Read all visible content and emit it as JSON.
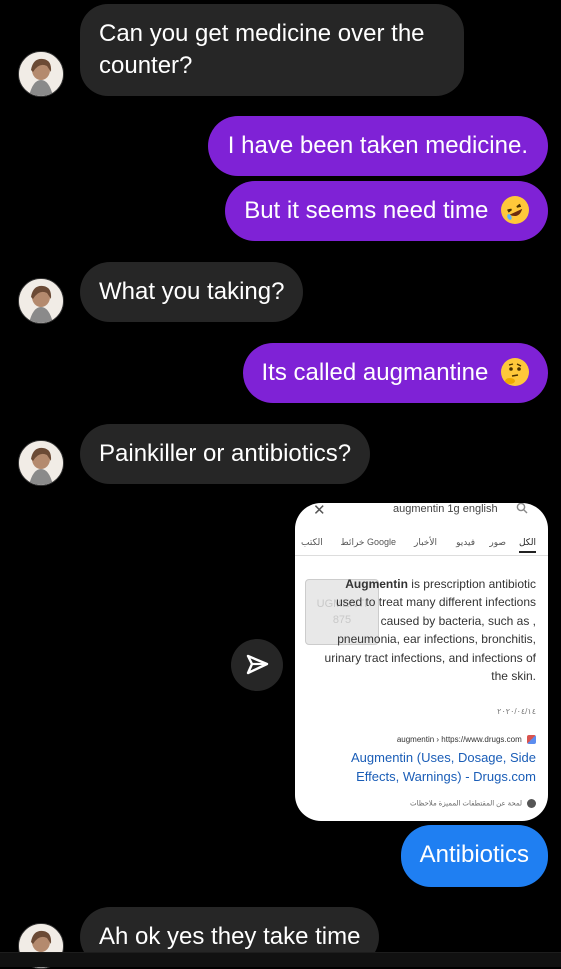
{
  "messages": [
    {
      "text_line1": "Can you get medicine over the",
      "text_line2": "counter?"
    },
    {
      "text": "I have been taken medicine."
    },
    {
      "text": "But it seems need time"
    },
    {
      "text": "What you taking?"
    },
    {
      "text": "Its called augmantine"
    },
    {
      "text": "Painkiller or antibiotics?"
    },
    {
      "text": "Antibiotics"
    },
    {
      "text": "Ah ok yes they take time"
    }
  ],
  "shared_card": {
    "search_query": "augmentin 1g english",
    "tabs": [
      "الكل",
      "صور",
      "فيديو",
      "الأخبار",
      "خرائط Google",
      "الكتب"
    ],
    "pill_text_line1": "UGMENTI",
    "pill_text_line2": "875",
    "snippet_bold": "Augmentin",
    "snippet_rest": " is prescription antibiotic used to treat many different infections caused by bacteria, such as , pneumonia, ear infections, bronchitis, urinary tract infections, and infections of the skin.",
    "date": "٢٠٢٠/٠٤/١٤",
    "url": "augmentin › https://www.drugs.com",
    "link_title": "Augmentin (Uses, Dosage, Side Effects, Warnings) - Drugs.com",
    "footer": "لمحة عن المقتطفات المميزة   ملاحظات"
  },
  "colors": {
    "background": "#000000",
    "incoming_bubble": "#262626",
    "outgoing_bubble_purple": "#7f22d6",
    "outgoing_bubble_blue": "#1f7ff2",
    "link": "#1a5db7"
  },
  "icons": {
    "emoji_laughing": "rolling-on-floor-laughing-emoji",
    "emoji_thinking": "thinking-face-emoji",
    "share": "send-arrow-icon"
  }
}
